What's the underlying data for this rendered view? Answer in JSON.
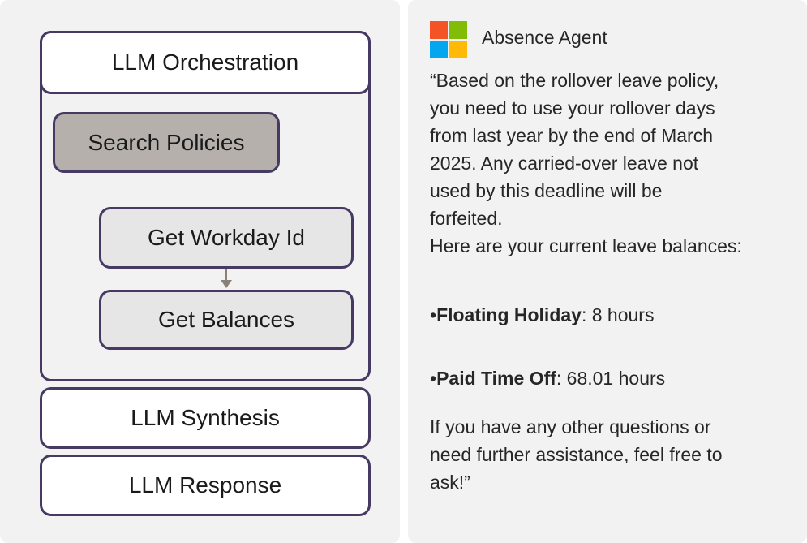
{
  "diagram": {
    "orchestration": "LLM Orchestration",
    "search_policies": "Search Policies",
    "get_workday_id": "Get Workday Id",
    "get_balances": "Get Balances",
    "synthesis": "LLM Synthesis",
    "response": "LLM Response"
  },
  "agent": {
    "name": "Absence Agent",
    "logo_icon": "microsoft-logo-icon",
    "message": {
      "line1": "“Based on the rollover leave policy,",
      "line2": "you need to use your rollover days",
      "line3": "from last year by the end of March",
      "line4": "2025. Any carried-over leave not",
      "line5": "used by this deadline will be",
      "line6": "forfeited.",
      "line7": "Here are your current leave balances:"
    },
    "balances": [
      {
        "bullet": "•",
        "label": "Floating Holiday",
        "value": ": 8 hours"
      },
      {
        "bullet": "•",
        "label": "Paid Time Off",
        "value": ": 68.01 hours"
      }
    ],
    "closing": {
      "line1": "If you have any other questions or",
      "line2": "need further assistance, feel free to",
      "line3": "ask!”"
    }
  },
  "colors": {
    "border": "#463a63",
    "search_fill": "#b5b0ab",
    "tool_fill": "#e6e6e6",
    "panel_bg": "#f2f2f2"
  }
}
